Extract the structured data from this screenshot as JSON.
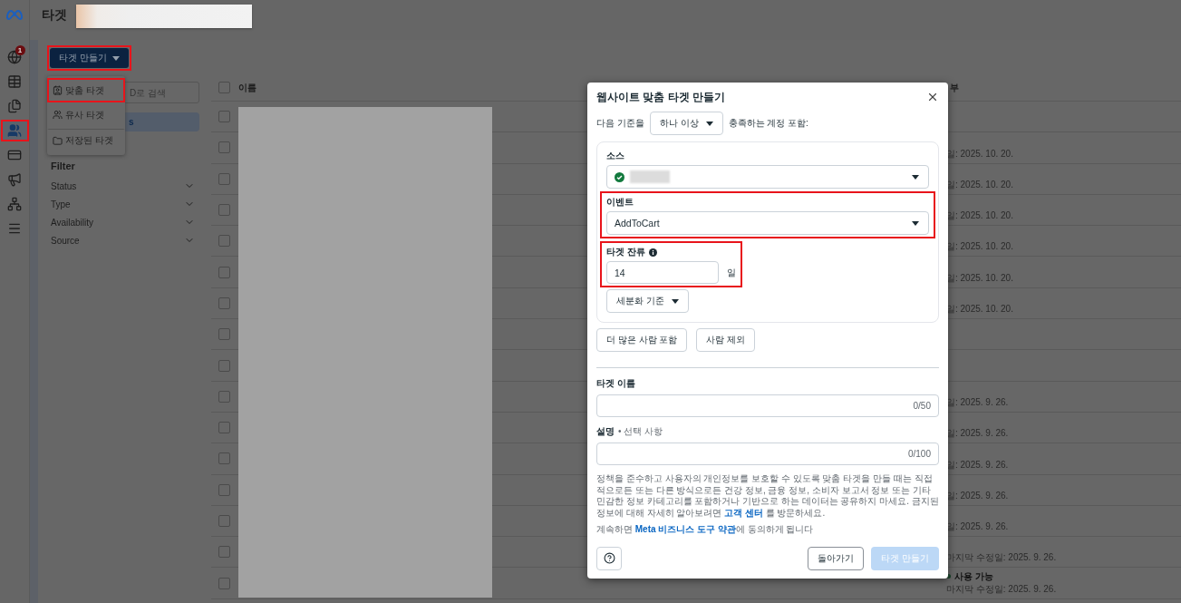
{
  "rail": {
    "items": [
      {
        "kind": "globe",
        "selected": false,
        "highlighted": false,
        "badge": "1"
      },
      {
        "kind": "table",
        "selected": false,
        "highlighted": false
      },
      {
        "kind": "pages",
        "selected": false,
        "highlighted": false
      },
      {
        "kind": "audience",
        "selected": true,
        "highlighted": true
      },
      {
        "kind": "billing",
        "selected": false,
        "highlighted": false
      },
      {
        "kind": "campaign",
        "selected": false,
        "highlighted": false
      },
      {
        "kind": "network",
        "selected": false,
        "highlighted": false
      },
      {
        "kind": "menu",
        "selected": false,
        "highlighted": false
      }
    ]
  },
  "header": {
    "title": "타겟"
  },
  "create_button": {
    "label": "타겟 만들기",
    "highlighted": true
  },
  "create_menu": {
    "items": [
      {
        "kind": "custom",
        "label": "맞춤 타겟",
        "highlighted": true,
        "separated": false
      },
      {
        "kind": "lookalike",
        "label": "유사 타겟",
        "highlighted": false,
        "separated": false
      },
      {
        "kind": "saved",
        "label": "저장된 타겟",
        "highlighted": false,
        "separated": true
      }
    ]
  },
  "search": {
    "placeholder": "D로 검색"
  },
  "sidebar": {
    "items": [
      {
        "label": "s",
        "selected": true
      }
    ]
  },
  "filter": {
    "title": "Filter",
    "items": [
      {
        "label": "Status",
        "expanded": false
      },
      {
        "label": "Type",
        "expanded": false
      },
      {
        "label": "Availability",
        "expanded": false
      },
      {
        "label": "Source",
        "expanded": false
      }
    ]
  },
  "table": {
    "columns": [
      "이름",
      "부"
    ],
    "all_checked": false,
    "rows": [
      {
        "checked": false
      },
      {
        "checked": false,
        "date": "일: 2025. 10. 20."
      },
      {
        "checked": false,
        "date": "일: 2025. 10. 20."
      },
      {
        "checked": false,
        "date": "일: 2025. 10. 20."
      },
      {
        "checked": false,
        "date": "일: 2025. 10. 20."
      },
      {
        "checked": false,
        "date": "일: 2025. 10. 20."
      },
      {
        "checked": false,
        "date": "일: 2025. 10. 20."
      },
      {
        "checked": false
      },
      {
        "checked": false
      },
      {
        "checked": false,
        "date": "일: 2025. 9. 26."
      },
      {
        "checked": false,
        "date": "일: 2025. 9. 26."
      },
      {
        "checked": false,
        "date": "일: 2025. 9. 26."
      },
      {
        "checked": false,
        "date": "일: 2025. 9. 26."
      },
      {
        "checked": false,
        "date": "일: 2025. 9. 26."
      },
      {
        "checked": false,
        "date": "마지막 수정일: 2025. 9. 26."
      },
      {
        "checked": false,
        "status": "사용 가능",
        "color": "#0b3d1e",
        "date": "마지막 수정일: 2025. 9. 26."
      }
    ]
  },
  "modal": {
    "title": "웹사이트 맞춤 타겟 만들기",
    "criteria": {
      "prefix": "다음 기준을",
      "value": "하나 이상",
      "suffix": "충족하는 계정 포함:"
    },
    "source": {
      "label": "소스",
      "verified": true
    },
    "event": {
      "label": "이벤트",
      "value": "AddToCart",
      "highlighted": true
    },
    "retention": {
      "label": "타겟 잔류",
      "value": "14",
      "unit": "일",
      "highlighted": true
    },
    "refine_button": "세분화 기준",
    "actions": [
      "더 많은 사람 포함",
      "사람 제외"
    ],
    "name_field": {
      "label": "타겟 이름",
      "counter": "0/50"
    },
    "description_field": {
      "label": "설명",
      "optional": "• 선택 사항",
      "counter": "0/100"
    },
    "policy": {
      "before": "정책을 준수하고 사용자의 개인정보를 보호할 수 있도록 맞춤 타겟을 만들 때는 직접적으로든 또는 다른 방식으로든 건강 정보, 금융 정보, 소비자 보고서 정보 또는 기타 민감한 정보 카테고리를 포함하거나 기반으로 하는 데이터는 공유하지 마세요. 금지된 정보에 대해 자세히 알아보려면 ",
      "link": "고객 센터",
      "after": " 를 방문하세요."
    },
    "terms": {
      "before": "계속하면 ",
      "link": "Meta 비즈니스 도구 약관",
      "after": "에 동의하게 됩니다"
    },
    "buttons": [
      {
        "label": "돌아가기",
        "disabled": false
      },
      {
        "label": "타겟 만들기",
        "disabled": true
      }
    ]
  }
}
